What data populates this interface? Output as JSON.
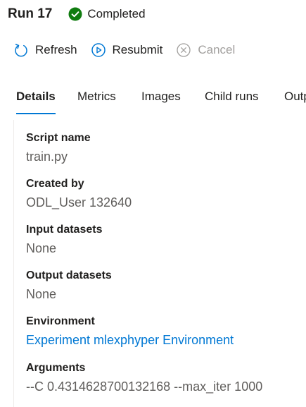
{
  "run": {
    "title": "Run 17",
    "status": "Completed",
    "status_icon": "checkmark-circle-icon",
    "status_color": "#107c10"
  },
  "commands": {
    "refresh": "Refresh",
    "resubmit": "Resubmit",
    "cancel": "Cancel",
    "accent_color": "#0078d4"
  },
  "tabs": [
    {
      "label": "Details",
      "active": true
    },
    {
      "label": "Metrics"
    },
    {
      "label": "Images"
    },
    {
      "label": "Child runs"
    },
    {
      "label": "Outputs"
    }
  ],
  "details": {
    "script_name": {
      "label": "Script name",
      "value": "train.py"
    },
    "created_by": {
      "label": "Created by",
      "value": "ODL_User 132640"
    },
    "input_datasets": {
      "label": "Input datasets",
      "value": "None"
    },
    "output_datasets": {
      "label": "Output datasets",
      "value": "None"
    },
    "environment": {
      "label": "Environment",
      "value": "Experiment mlexphyper Environment"
    },
    "arguments": {
      "label": "Arguments",
      "value": "--C 0.4314628700132168 --max_iter 1000"
    }
  }
}
